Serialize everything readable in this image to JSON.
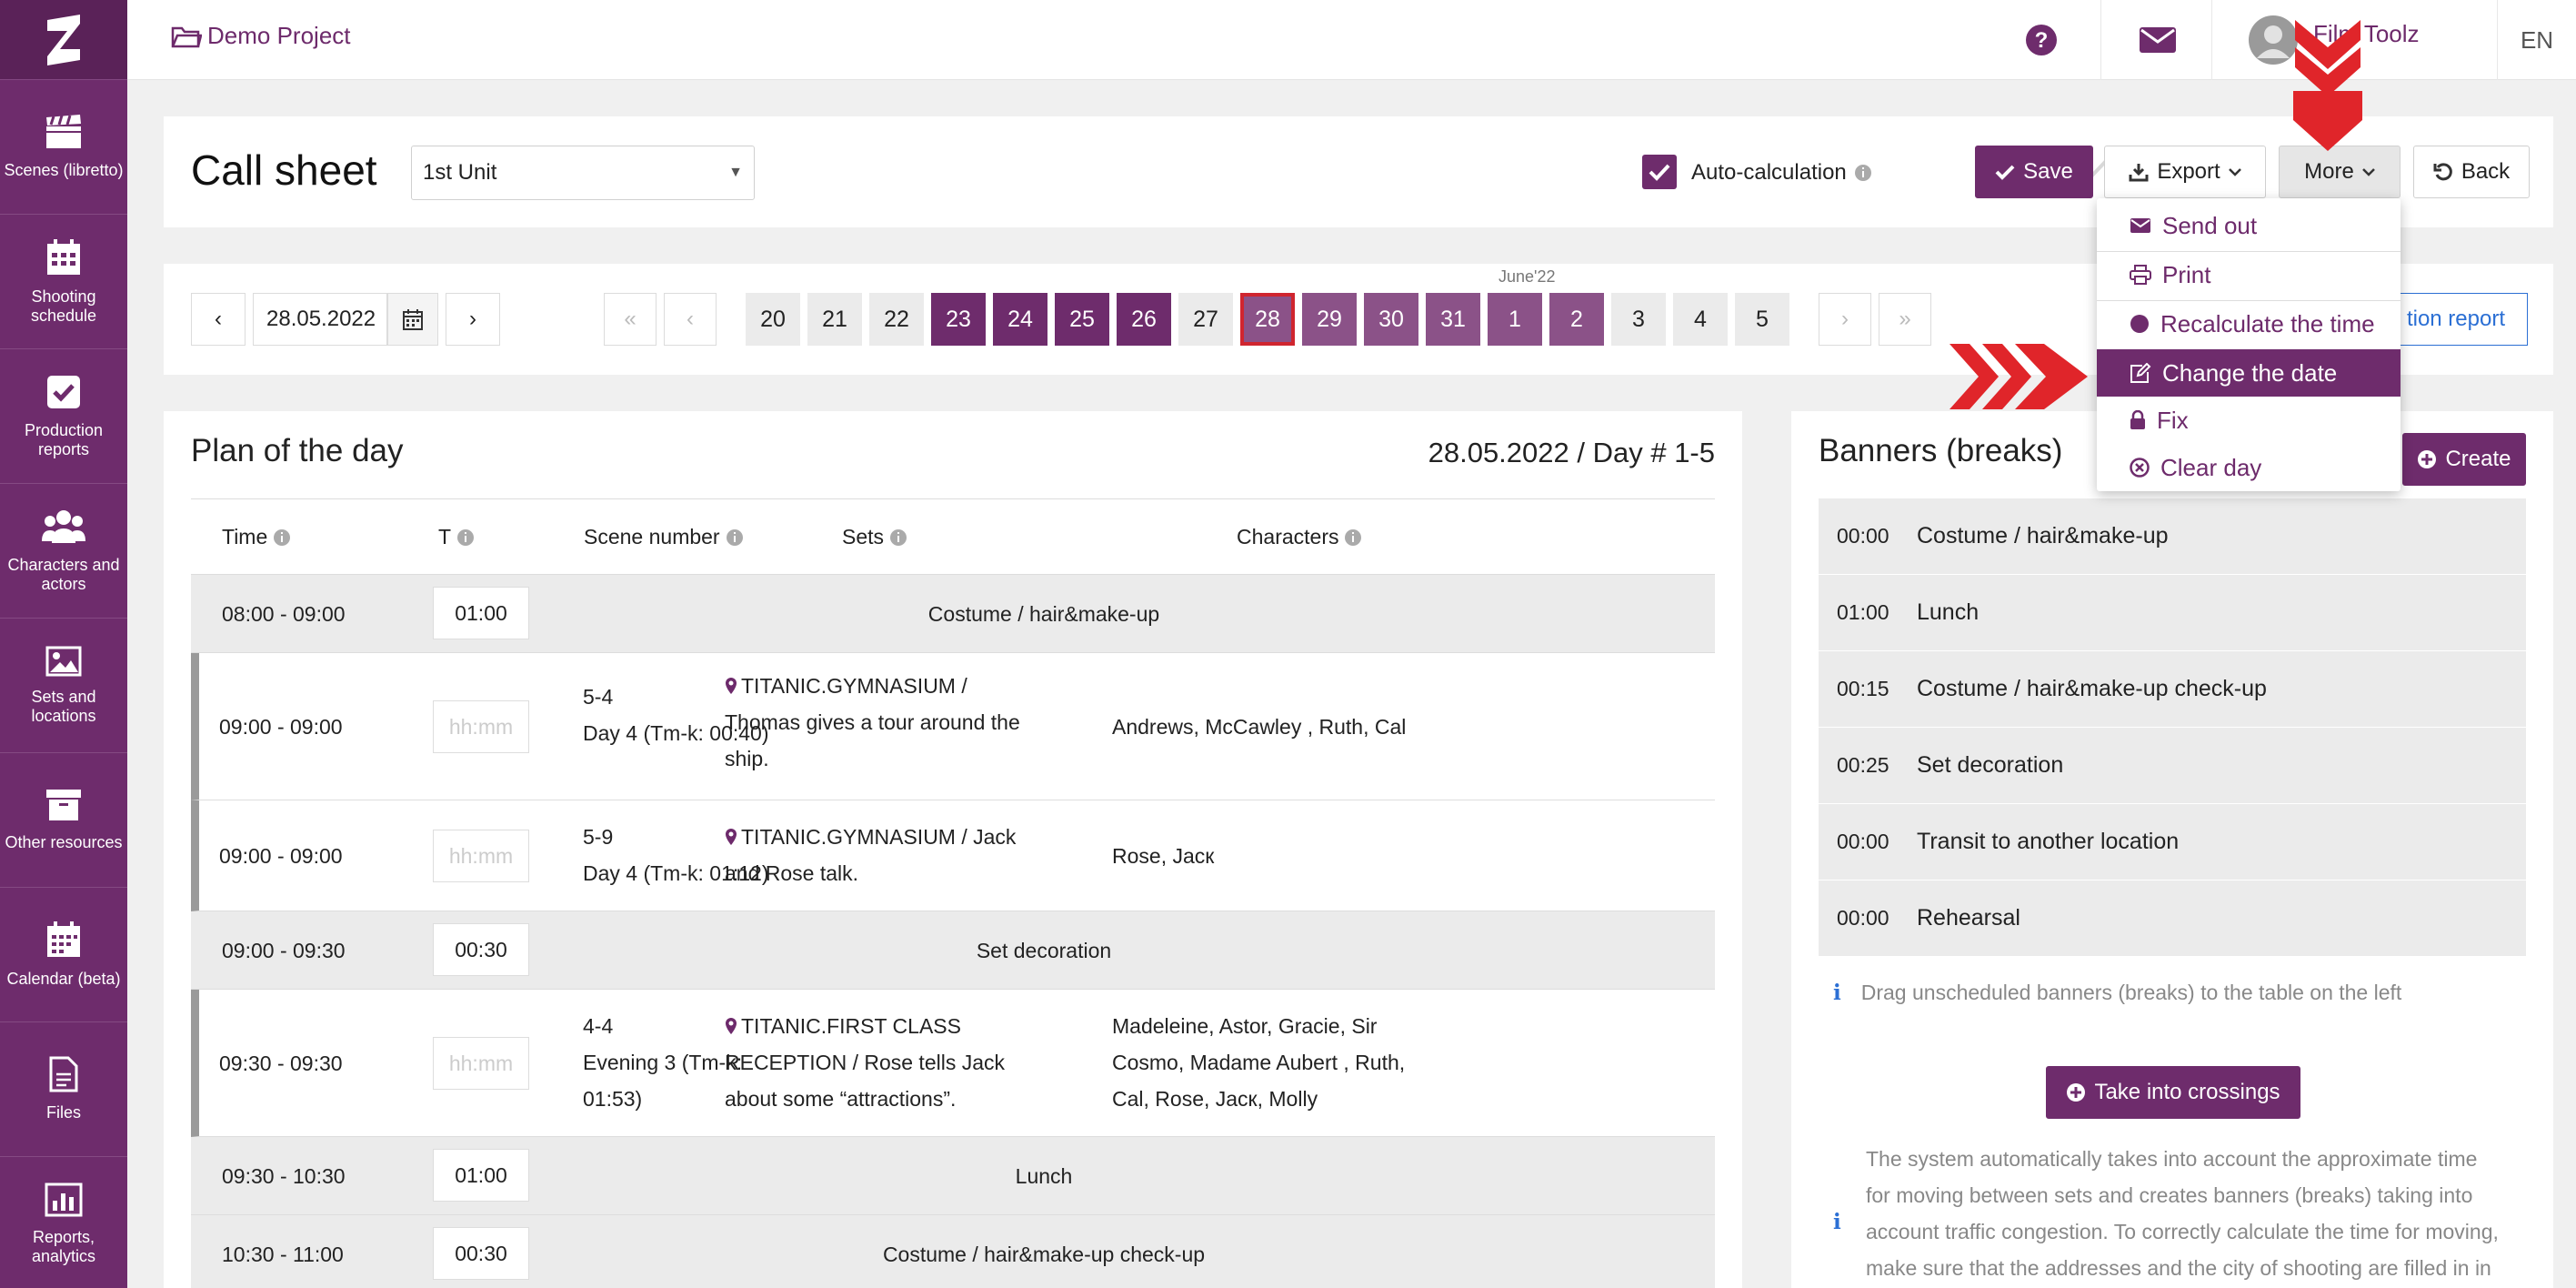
{
  "app": {
    "brand_color": "#6e2c6c",
    "logo": "film-toolz-logo"
  },
  "sidebar": {
    "items": [
      {
        "label": "Scenes (libretto)",
        "icon": "clapperboard-icon"
      },
      {
        "label": "Shooting schedule",
        "icon": "calendar-grid-icon"
      },
      {
        "label": "Production reports",
        "icon": "check-square-icon"
      },
      {
        "label": "Characters and actors",
        "icon": "users-icon"
      },
      {
        "label": "Sets and locations",
        "icon": "image-icon"
      },
      {
        "label": "Other resources",
        "icon": "archive-box-icon"
      },
      {
        "label": "Calendar (beta)",
        "icon": "calendar-icon"
      },
      {
        "label": "Files",
        "icon": "file-icon"
      },
      {
        "label": "Reports, analytics",
        "icon": "bar-chart-icon"
      }
    ]
  },
  "topbar": {
    "project": "Demo Project",
    "user": "Film Toolz",
    "lang": "EN"
  },
  "header": {
    "title": "Call sheet",
    "unit": "1st Unit",
    "auto_calc_label": "Auto-calculation",
    "auto_calc_checked": true,
    "save": "Save",
    "export": "Export",
    "more": "More",
    "back": "Back"
  },
  "calendar": {
    "date": "28.05.2022",
    "month": "June'22",
    "days": [
      "20",
      "21",
      "22",
      "23",
      "24",
      "25",
      "26",
      "27",
      "28",
      "29",
      "30",
      "31",
      "1",
      "2",
      "3",
      "4",
      "5"
    ],
    "report_partial": "tion report"
  },
  "more_menu": [
    {
      "label": "Send out",
      "icon": "envelope-icon"
    },
    {
      "label": "Print",
      "icon": "printer-icon"
    },
    {
      "label": "Recalculate the time",
      "icon": "circle-icon"
    },
    {
      "label": "Change the date",
      "icon": "edit-icon",
      "active": true
    },
    {
      "label": "Fix",
      "icon": "lock-icon"
    },
    {
      "label": "Clear day",
      "icon": "x-circle-icon"
    }
  ],
  "plan": {
    "title": "Plan of the day",
    "date_label": "28.05.2022 / Day # 1-5",
    "columns": [
      "Time",
      "T",
      "Scene number",
      "Sets",
      "Characters"
    ],
    "rows": [
      {
        "type": "break",
        "time": "08:00 - 09:00",
        "dur": "01:00",
        "name": "Costume / hair&make-up"
      },
      {
        "type": "scene",
        "time": "09:00 - 09:00",
        "dur": "hh:mm",
        "scene": "5-4",
        "day": "Day 4 (Tm-k: 00:40)",
        "set_lines": [
          "TITANIC.GYMNASIUM /",
          "Thomas gives a tour around the",
          "ship."
        ],
        "chars": [
          "Andrews, McCawley , Ruth, Cal"
        ]
      },
      {
        "type": "scene",
        "time": "09:00 - 09:00",
        "dur": "hh:mm",
        "scene": "5-9",
        "day": "Day 4 (Tm-k: 01:12)",
        "set_lines": [
          "TITANIC.GYMNASIUM / Jack",
          "and Rose talk."
        ],
        "chars": [
          "Rose, Jacк"
        ]
      },
      {
        "type": "break",
        "time": "09:00 - 09:30",
        "dur": "00:30",
        "name": "Set decoration"
      },
      {
        "type": "scene",
        "time": "09:30 - 09:30",
        "dur": "hh:mm",
        "scene": "4-4",
        "day_lines": [
          "Evening 3 (Tm-k:",
          "01:53)"
        ],
        "set_lines": [
          "TITANIC.FIRST CLASS",
          "RECEPTION / Rose tells Jack",
          "about some “attractions”."
        ],
        "chars": [
          "Madeleine, Astor, Gracie, Sir",
          "Cosmo, Madame Aubert , Ruth,",
          "Cal, Rose, Jacк, Molly"
        ]
      },
      {
        "type": "break",
        "time": "09:30 - 10:30",
        "dur": "01:00",
        "name": "Lunch"
      },
      {
        "type": "break",
        "time": "10:30 - 11:00",
        "dur": "00:30",
        "name": "Costume / hair&make-up check-up"
      }
    ]
  },
  "banners": {
    "title": "Banners (breaks)",
    "create": "Create",
    "items": [
      {
        "time": "00:00",
        "name": "Costume / hair&make-up"
      },
      {
        "time": "01:00",
        "name": "Lunch"
      },
      {
        "time": "00:15",
        "name": "Costume / hair&make-up check-up"
      },
      {
        "time": "00:25",
        "name": "Set decoration"
      },
      {
        "time": "00:00",
        "name": "Transit to another location"
      },
      {
        "time": "00:00",
        "name": "Rehearsal"
      }
    ],
    "hint": "Drag unscheduled banners (breaks) to the table on the left",
    "take_crossings": "Take into crossings",
    "note_lines": [
      "The system automatically takes into account the approximate time",
      "for moving between sets and creates banners (breaks) taking into",
      "account traffic congestion. To correctly calculate the time for moving,",
      "make sure that the addresses and the city of shooting are filled in in"
    ]
  }
}
